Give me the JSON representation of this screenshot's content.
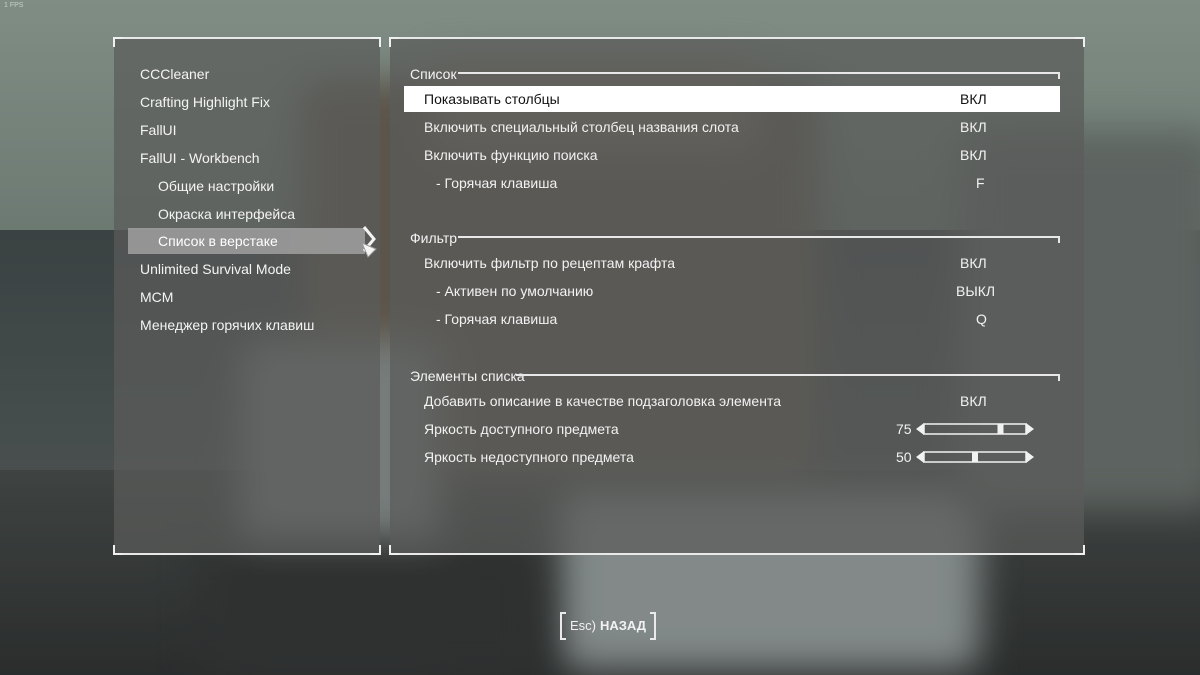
{
  "fps_counter": "1 FPS",
  "sidebar": {
    "items": [
      {
        "label": "CCCleaner",
        "sub": false,
        "selected": false
      },
      {
        "label": "Crafting Highlight Fix",
        "sub": false,
        "selected": false
      },
      {
        "label": "FallUI",
        "sub": false,
        "selected": false
      },
      {
        "label": "FallUI - Workbench",
        "sub": false,
        "selected": false
      },
      {
        "label": "Общие настройки",
        "sub": true,
        "selected": false
      },
      {
        "label": "Окраска интерфейса",
        "sub": true,
        "selected": false
      },
      {
        "label": "Список в верстаке",
        "sub": true,
        "selected": true
      },
      {
        "label": "Unlimited Survival Mode",
        "sub": false,
        "selected": false
      },
      {
        "label": "MCM",
        "sub": false,
        "selected": false
      },
      {
        "label": "Менеджер горячих клавиш",
        "sub": false,
        "selected": false
      }
    ]
  },
  "sections": [
    {
      "title": "Список",
      "rows": [
        {
          "label": "Показывать столбцы",
          "value": "ВКЛ",
          "highlight": true
        },
        {
          "label": "Включить специальный столбец названия слота",
          "value": "ВКЛ"
        },
        {
          "label": "Включить функцию поиска",
          "value": "ВКЛ"
        },
        {
          "label": "- Горячая клавиша",
          "value": "F",
          "indent": true
        }
      ]
    },
    {
      "title": "Фильтр",
      "rows": [
        {
          "label": "Включить фильтр по рецептам крафта",
          "value": "ВКЛ"
        },
        {
          "label": "- Активен по умолчанию",
          "value": "ВЫКЛ",
          "indent": true
        },
        {
          "label": "- Горячая клавиша",
          "value": "Q",
          "indent": true
        }
      ]
    },
    {
      "title": "Элементы списка",
      "rows": [
        {
          "label": "Добавить описание в качестве подзаголовка элемента",
          "value": "ВКЛ"
        },
        {
          "label": "Яркость доступного предмета",
          "slider": "75",
          "level": 0.75
        },
        {
          "label": "Яркость недоступного предмета",
          "slider": "50",
          "level": 0.5
        }
      ]
    }
  ],
  "footer": {
    "back_key": "Esc)",
    "back_label": "НАЗАД"
  }
}
